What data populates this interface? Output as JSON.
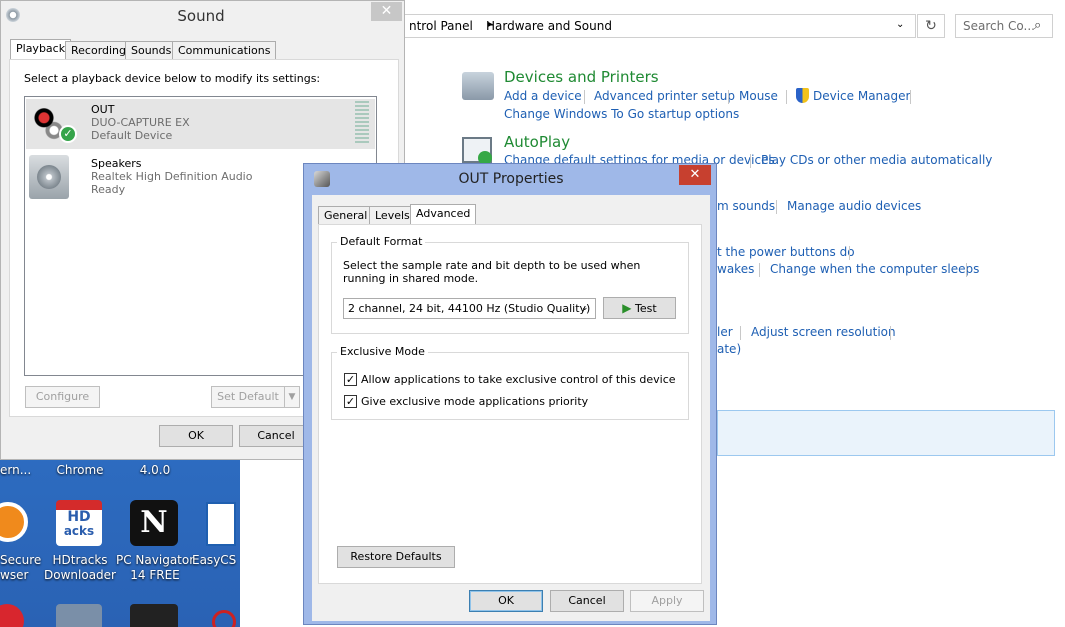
{
  "desktop": {
    "icons": [
      {
        "label1": "ern...",
        "label2": ""
      },
      {
        "label1": "Chrome",
        "label2": ""
      },
      {
        "label1": "4.0.0",
        "label2": ""
      },
      {
        "label1": "Secure",
        "label2": "wser"
      },
      {
        "label1": "HDtracks",
        "label2": "Downloader"
      },
      {
        "label1": "PC Navigator",
        "label2": "14 FREE"
      },
      {
        "label1": "EasyCS",
        "label2": ""
      }
    ],
    "hd_badge": "HD",
    "hd_badge2": "acks",
    "nav_badge": "N"
  },
  "control_panel": {
    "breadcrumb_1": "ntrol Panel",
    "breadcrumb_sep": "▸",
    "breadcrumb_2": "Hardware and Sound",
    "search_placeholder": "Search Co...",
    "sections": [
      {
        "title": "Devices and Printers",
        "links": [
          "Add a device",
          "Advanced printer setup",
          "Mouse",
          "Device Manager"
        ],
        "links2": [
          "Change Windows To Go startup options"
        ]
      },
      {
        "title": "AutoPlay",
        "links": [
          "Change default settings for media or devices",
          "Play CDs or other media automatically"
        ]
      }
    ],
    "partial_links": {
      "sounds": "m sounds",
      "manage_audio": "Manage audio devices",
      "power_buttons": "t the power buttons do",
      "wakes": "wakes",
      "sleeps": "Change when the computer sleeps",
      "ler": "ler",
      "resolution": "Adjust screen resolution",
      "ate": "ate)"
    }
  },
  "sound_window": {
    "title": "Sound",
    "tabs": [
      "Playback",
      "Recording",
      "Sounds",
      "Communications"
    ],
    "instruction": "Select a playback device below to modify its settings:",
    "devices": [
      {
        "name": "OUT",
        "line2": "DUO-CAPTURE EX",
        "line3": "Default Device"
      },
      {
        "name": "Speakers",
        "line2": "Realtek High Definition Audio",
        "line3": "Ready"
      }
    ],
    "configure": "Configure",
    "set_default": "Set Default",
    "ok": "OK",
    "cancel": "Cancel"
  },
  "props_dialog": {
    "title": "OUT Properties",
    "tabs": [
      "General",
      "Levels",
      "Advanced"
    ],
    "default_format_title": "Default Format",
    "default_format_desc": "Select the sample rate and bit depth to be used when running in shared mode.",
    "format_value": "2 channel, 24 bit, 44100 Hz (Studio Quality)",
    "test": "Test",
    "exclusive_title": "Exclusive Mode",
    "exclusive_opt1": "Allow applications to take exclusive control of this device",
    "exclusive_opt2": "Give exclusive mode applications priority",
    "exclusive_opt1_checked": true,
    "exclusive_opt2_checked": true,
    "restore": "Restore Defaults",
    "ok": "OK",
    "cancel": "Cancel",
    "apply": "Apply"
  }
}
